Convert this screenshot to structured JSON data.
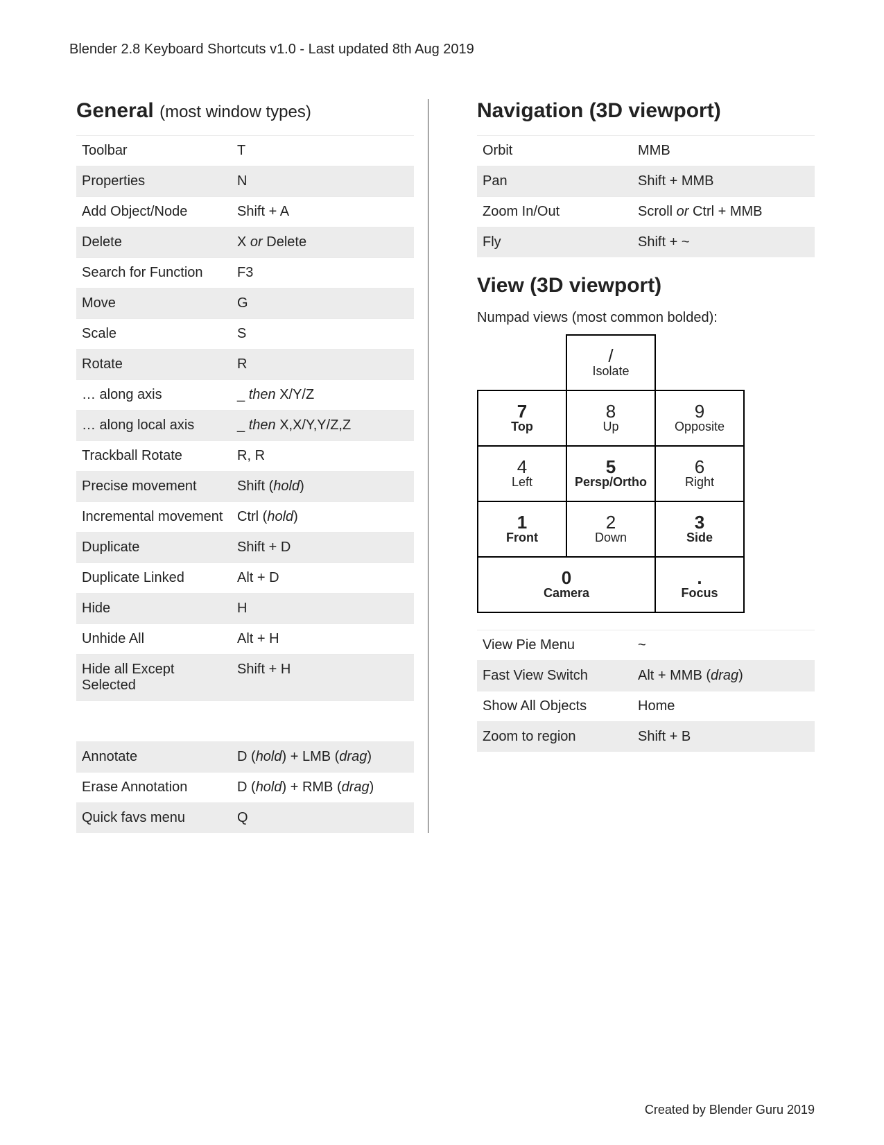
{
  "header": "Blender 2.8 Keyboard Shortcuts v1.0 - Last updated 8th Aug 2019",
  "footer": "Created by Blender Guru 2019",
  "general": {
    "title": "General",
    "subtitle": "(most window types)",
    "rows1": [
      {
        "label": "Toolbar",
        "key": "T"
      },
      {
        "label": "Properties",
        "key": "N"
      },
      {
        "label": "Add Object/Node",
        "key": "Shift + A"
      },
      {
        "label": "Delete",
        "key": "X <em>or</em> Delete"
      },
      {
        "label": "Search for Function",
        "key": "F3"
      },
      {
        "label": "Move",
        "key": "G"
      },
      {
        "label": "Scale",
        "key": "S"
      },
      {
        "label": "Rotate",
        "key": "R"
      },
      {
        "label": "… along axis",
        "key": "_ <em>then</em> X/Y/Z"
      },
      {
        "label": "… along local axis",
        "key": "_ <em>then</em> X,X/Y,Y/Z,Z"
      },
      {
        "label": "Trackball Rotate",
        "key": "R, R"
      },
      {
        "label": "Precise movement",
        "key": "Shift (<em>hold</em>)"
      },
      {
        "label": "Incremental movement",
        "key": "Ctrl (<em>hold</em>)"
      },
      {
        "label": "Duplicate",
        "key": "Shift + D"
      },
      {
        "label": "Duplicate Linked",
        "key": "Alt + D"
      },
      {
        "label": "Hide",
        "key": "H"
      },
      {
        "label": "Unhide All",
        "key": "Alt + H"
      },
      {
        "label": "Hide all Except Selected",
        "key": "Shift + H"
      }
    ],
    "rows2": [
      {
        "label": "Annotate",
        "key": "D (<em>hold</em>) + LMB (<em>drag</em>)"
      },
      {
        "label": "Erase Annotation",
        "key": "D (<em>hold</em>) + RMB (<em>drag</em>)"
      },
      {
        "label": "Quick favs menu",
        "key": "Q"
      }
    ]
  },
  "navigation": {
    "title": "Navigation (3D viewport)",
    "rows": [
      {
        "label": "Orbit",
        "key": "MMB"
      },
      {
        "label": "Pan",
        "key": "Shift + MMB"
      },
      {
        "label": "Zoom In/Out",
        "key": "Scroll <em>or</em> Ctrl + MMB"
      },
      {
        "label": "Fly",
        "key": "Shift + ~"
      }
    ]
  },
  "view": {
    "title": "View (3D viewport)",
    "subtitle": "Numpad views (most common bolded):",
    "numpad": {
      "r0": {
        "slash": {
          "key": "/",
          "label": "Isolate",
          "bold": false
        }
      },
      "r1": {
        "c0": {
          "key": "7",
          "label": "Top",
          "bold": true
        },
        "c1": {
          "key": "8",
          "label": "Up",
          "bold": false
        },
        "c2": {
          "key": "9",
          "label": "Opposite",
          "bold": false
        }
      },
      "r2": {
        "c0": {
          "key": "4",
          "label": "Left",
          "bold": false
        },
        "c1": {
          "key": "5",
          "label": "Persp/Ortho",
          "bold": true
        },
        "c2": {
          "key": "6",
          "label": "Right",
          "bold": false
        }
      },
      "r3": {
        "c0": {
          "key": "1",
          "label": "Front",
          "bold": true
        },
        "c1": {
          "key": "2",
          "label": "Down",
          "bold": false
        },
        "c2": {
          "key": "3",
          "label": "Side",
          "bold": true
        }
      },
      "r4": {
        "c0": {
          "key": "0",
          "label": "Camera",
          "bold": true
        },
        "c1": {
          "key": ".",
          "label": "Focus",
          "bold": true
        }
      }
    },
    "rows": [
      {
        "label": "View Pie Menu",
        "key": "~"
      },
      {
        "label": "Fast View Switch",
        "key": "Alt + MMB (<em>drag</em>)"
      },
      {
        "label": "Show All Objects",
        "key": "Home"
      },
      {
        "label": "Zoom to region",
        "key": "Shift + B"
      }
    ]
  }
}
